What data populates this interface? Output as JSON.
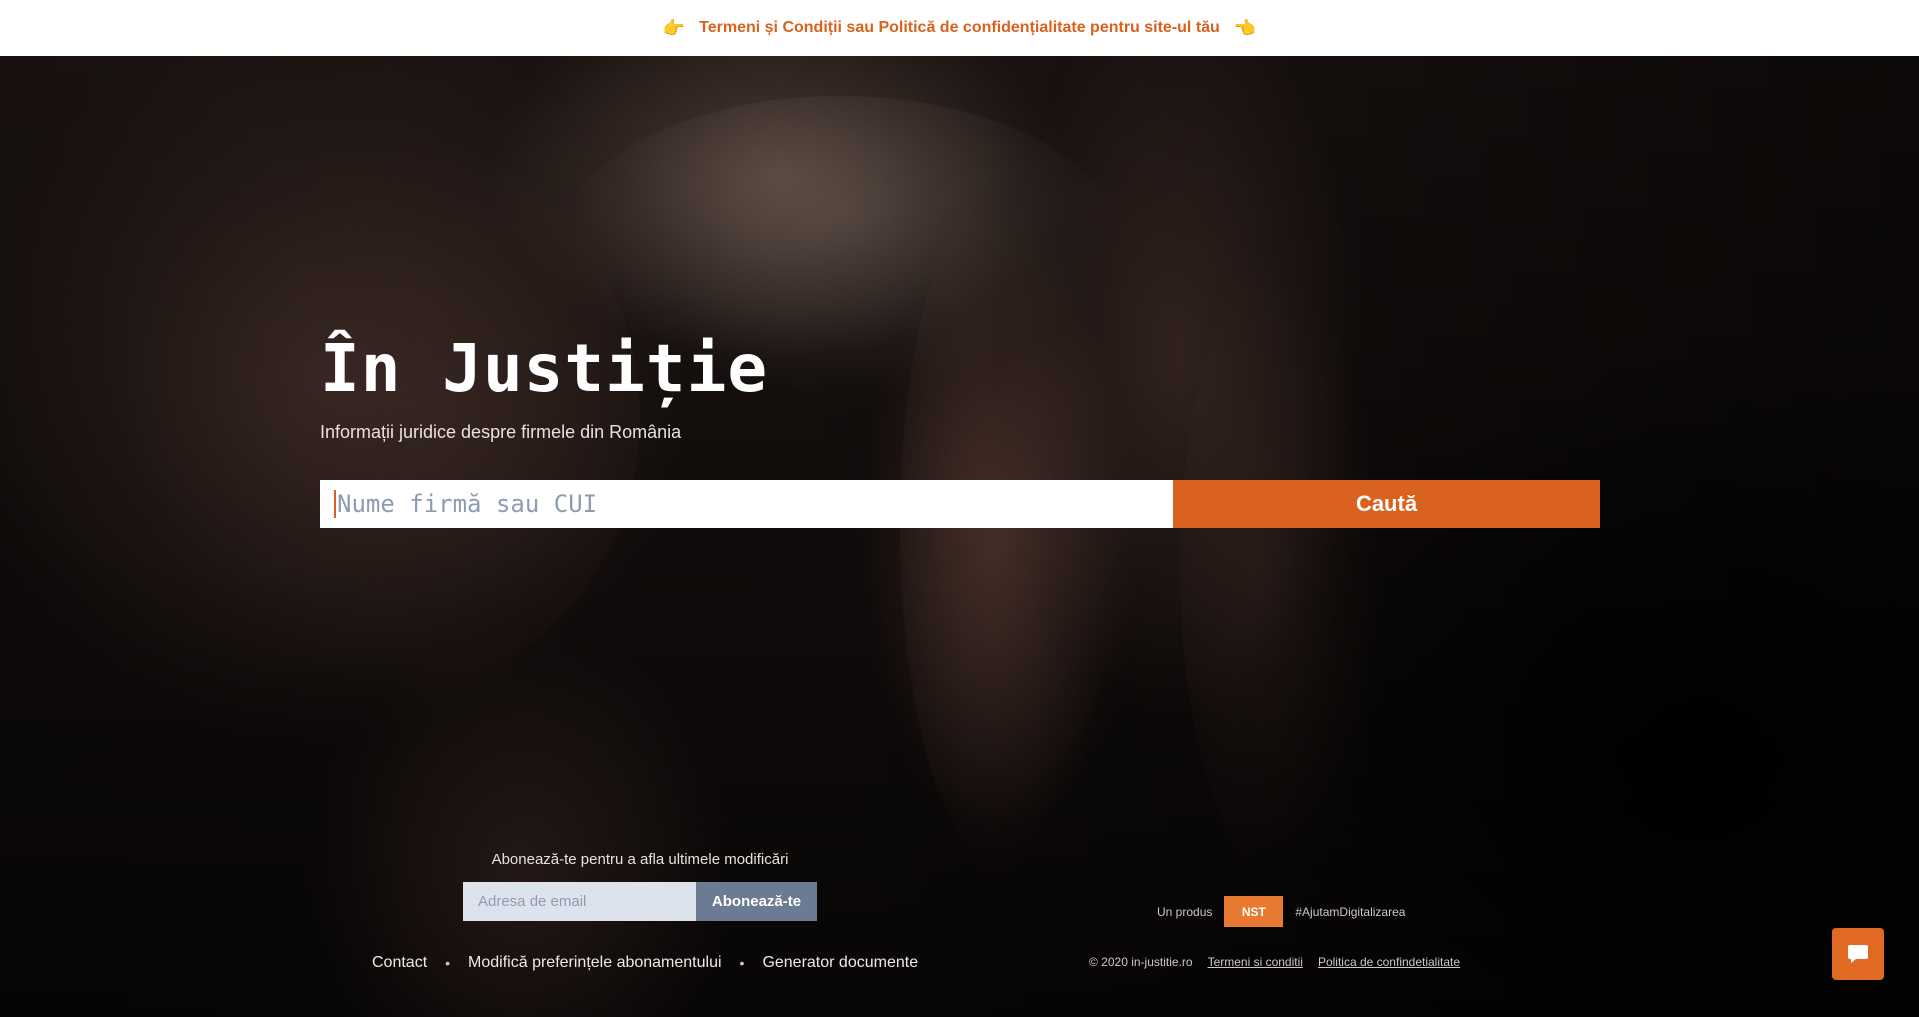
{
  "banner": {
    "left_icon": "hand-pointing-right-icon",
    "text": "Termeni și Condiții sau Politică de confidențialitate pentru site-ul tău",
    "right_icon": "hand-pointing-left-icon",
    "left_glyph": "👉",
    "right_glyph": "👈"
  },
  "hero": {
    "title": "În Justiție",
    "subtitle": "Informații juridice despre firmele din România"
  },
  "search": {
    "placeholder": "Nume firmă sau CUI",
    "value": "",
    "button_label": "Caută"
  },
  "subscribe": {
    "label": "Abonează-te pentru a afla ultimele modificări",
    "email_placeholder": "Adresa de email",
    "button_label": "Abonează-te"
  },
  "footer": {
    "links": [
      "Contact",
      "Modifică preferințele abonamentului",
      "Generator documente"
    ],
    "separator": "•",
    "product_label": "Un produs",
    "product_logo": "NST",
    "hashtag": "#AjutamDigitalizarea",
    "copyright": "© 2020 in-justitie.ro",
    "terms_link": "Termeni si conditii",
    "privacy_link": "Politica de confindetialitate"
  },
  "chat": {
    "icon": "chat-bubble-icon"
  },
  "colors": {
    "accent": "#d9621f",
    "subscribe_button": "#6b7b92",
    "input_bg": "#dde3ec"
  }
}
